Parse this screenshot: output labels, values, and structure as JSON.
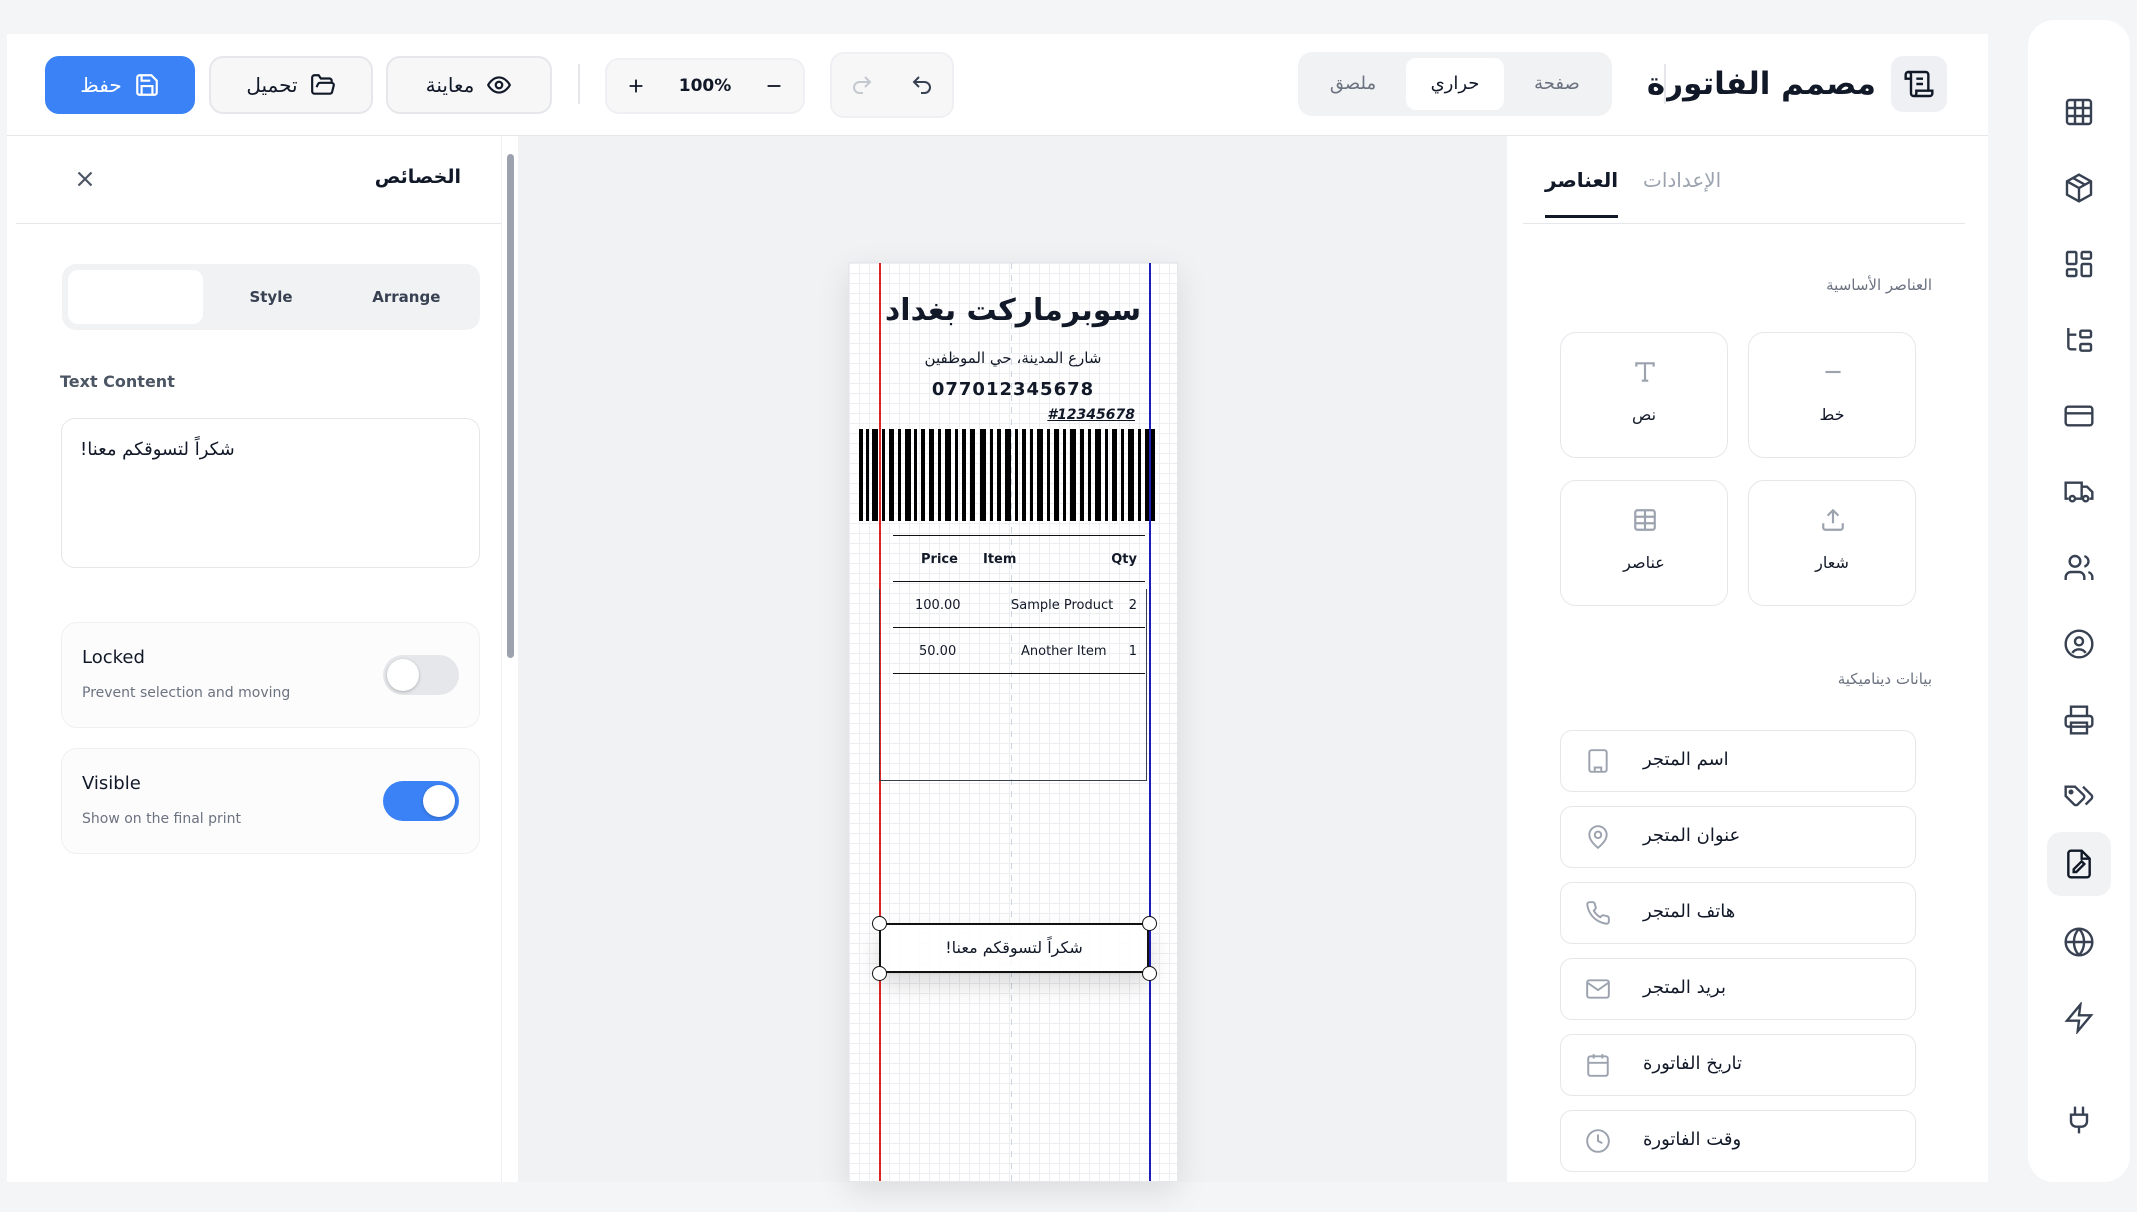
{
  "header": {
    "title": "مصمم الفاتورة",
    "paper_modes": [
      "صفحة",
      "حراري",
      "ملصق"
    ],
    "paper_mode_active": "حراري",
    "zoom": "100%",
    "save_label": "حفظ",
    "load_label": "تحميل",
    "preview_label": "معاينة"
  },
  "properties": {
    "title": "الخصائص",
    "tabs": [
      "",
      "Style",
      "Arrange"
    ],
    "text_content_label": "Text Content",
    "text_content_value": "شكراً لتسوقكم معنا!",
    "locked": {
      "title": "Locked",
      "subtitle": "Prevent selection and moving",
      "value": false
    },
    "visible": {
      "title": "Visible",
      "subtitle": "Show on the final print",
      "value": true
    }
  },
  "receipt": {
    "store_name": "سوبرماركت بغداد",
    "store_address": "شارع المدينة، حي الموظفين",
    "store_phone": "07701234567‍8",
    "invoice_number": "#12345678",
    "table_headers": {
      "price": "Price",
      "item": "Item",
      "qty": "Qty"
    },
    "rows": [
      {
        "price": "100.00",
        "item": "Sample Product",
        "qty": "2"
      },
      {
        "price": "50.00",
        "item": "Another Item",
        "qty": "1"
      }
    ],
    "footer_text": "شكراً لتسوقكم معنا!"
  },
  "elements_panel": {
    "tab_elements": "العناصر",
    "tab_settings": "الإعدادات",
    "basic_label": "العناصر الأساسية",
    "basic": [
      {
        "label": "نص",
        "icon": "text-icon"
      },
      {
        "label": "خط",
        "icon": "line-icon"
      },
      {
        "label": "عناصر",
        "icon": "table-icon"
      },
      {
        "label": "شعار",
        "icon": "upload-icon"
      }
    ],
    "dynamic_label": "بيانات ديناميكية",
    "dynamic": [
      {
        "label": "اسم المتجر",
        "icon": "building-icon"
      },
      {
        "label": "عنوان المتجر",
        "icon": "map-pin-icon"
      },
      {
        "label": "هاتف المتجر",
        "icon": "phone-icon"
      },
      {
        "label": "بريد المتجر",
        "icon": "mail-icon"
      },
      {
        "label": "تاريخ الفاتورة",
        "icon": "calendar-icon"
      },
      {
        "label": "وقت الفاتورة",
        "icon": "clock-icon"
      }
    ]
  },
  "colors": {
    "accent": "#3b82f6",
    "guide_left": "#dc2626",
    "guide_right": "#1d1db8"
  }
}
